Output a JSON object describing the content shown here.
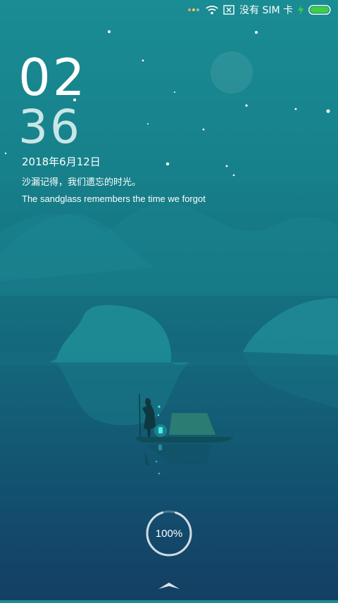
{
  "status_bar": {
    "sim_status": "没有 SIM 卡",
    "battery_color": "#3ecf3e",
    "icons": [
      "notification-dots-icon",
      "wifi-icon",
      "no-sim-icon",
      "charging-icon",
      "battery-icon"
    ]
  },
  "lockscreen": {
    "hour": "02",
    "minute": "36",
    "date": "2018年6月12日",
    "quote_cn": "沙漏记得，我们遗忘的时光。",
    "quote_en": "The sandglass remembers the time we forgot"
  },
  "charging": {
    "level_label": "100%",
    "level": 1.0
  },
  "colors": {
    "sky_top": "#1a8c93",
    "sky_bottom": "#133f63",
    "moon": "#ffffff",
    "lantern": "#45f0e0"
  }
}
